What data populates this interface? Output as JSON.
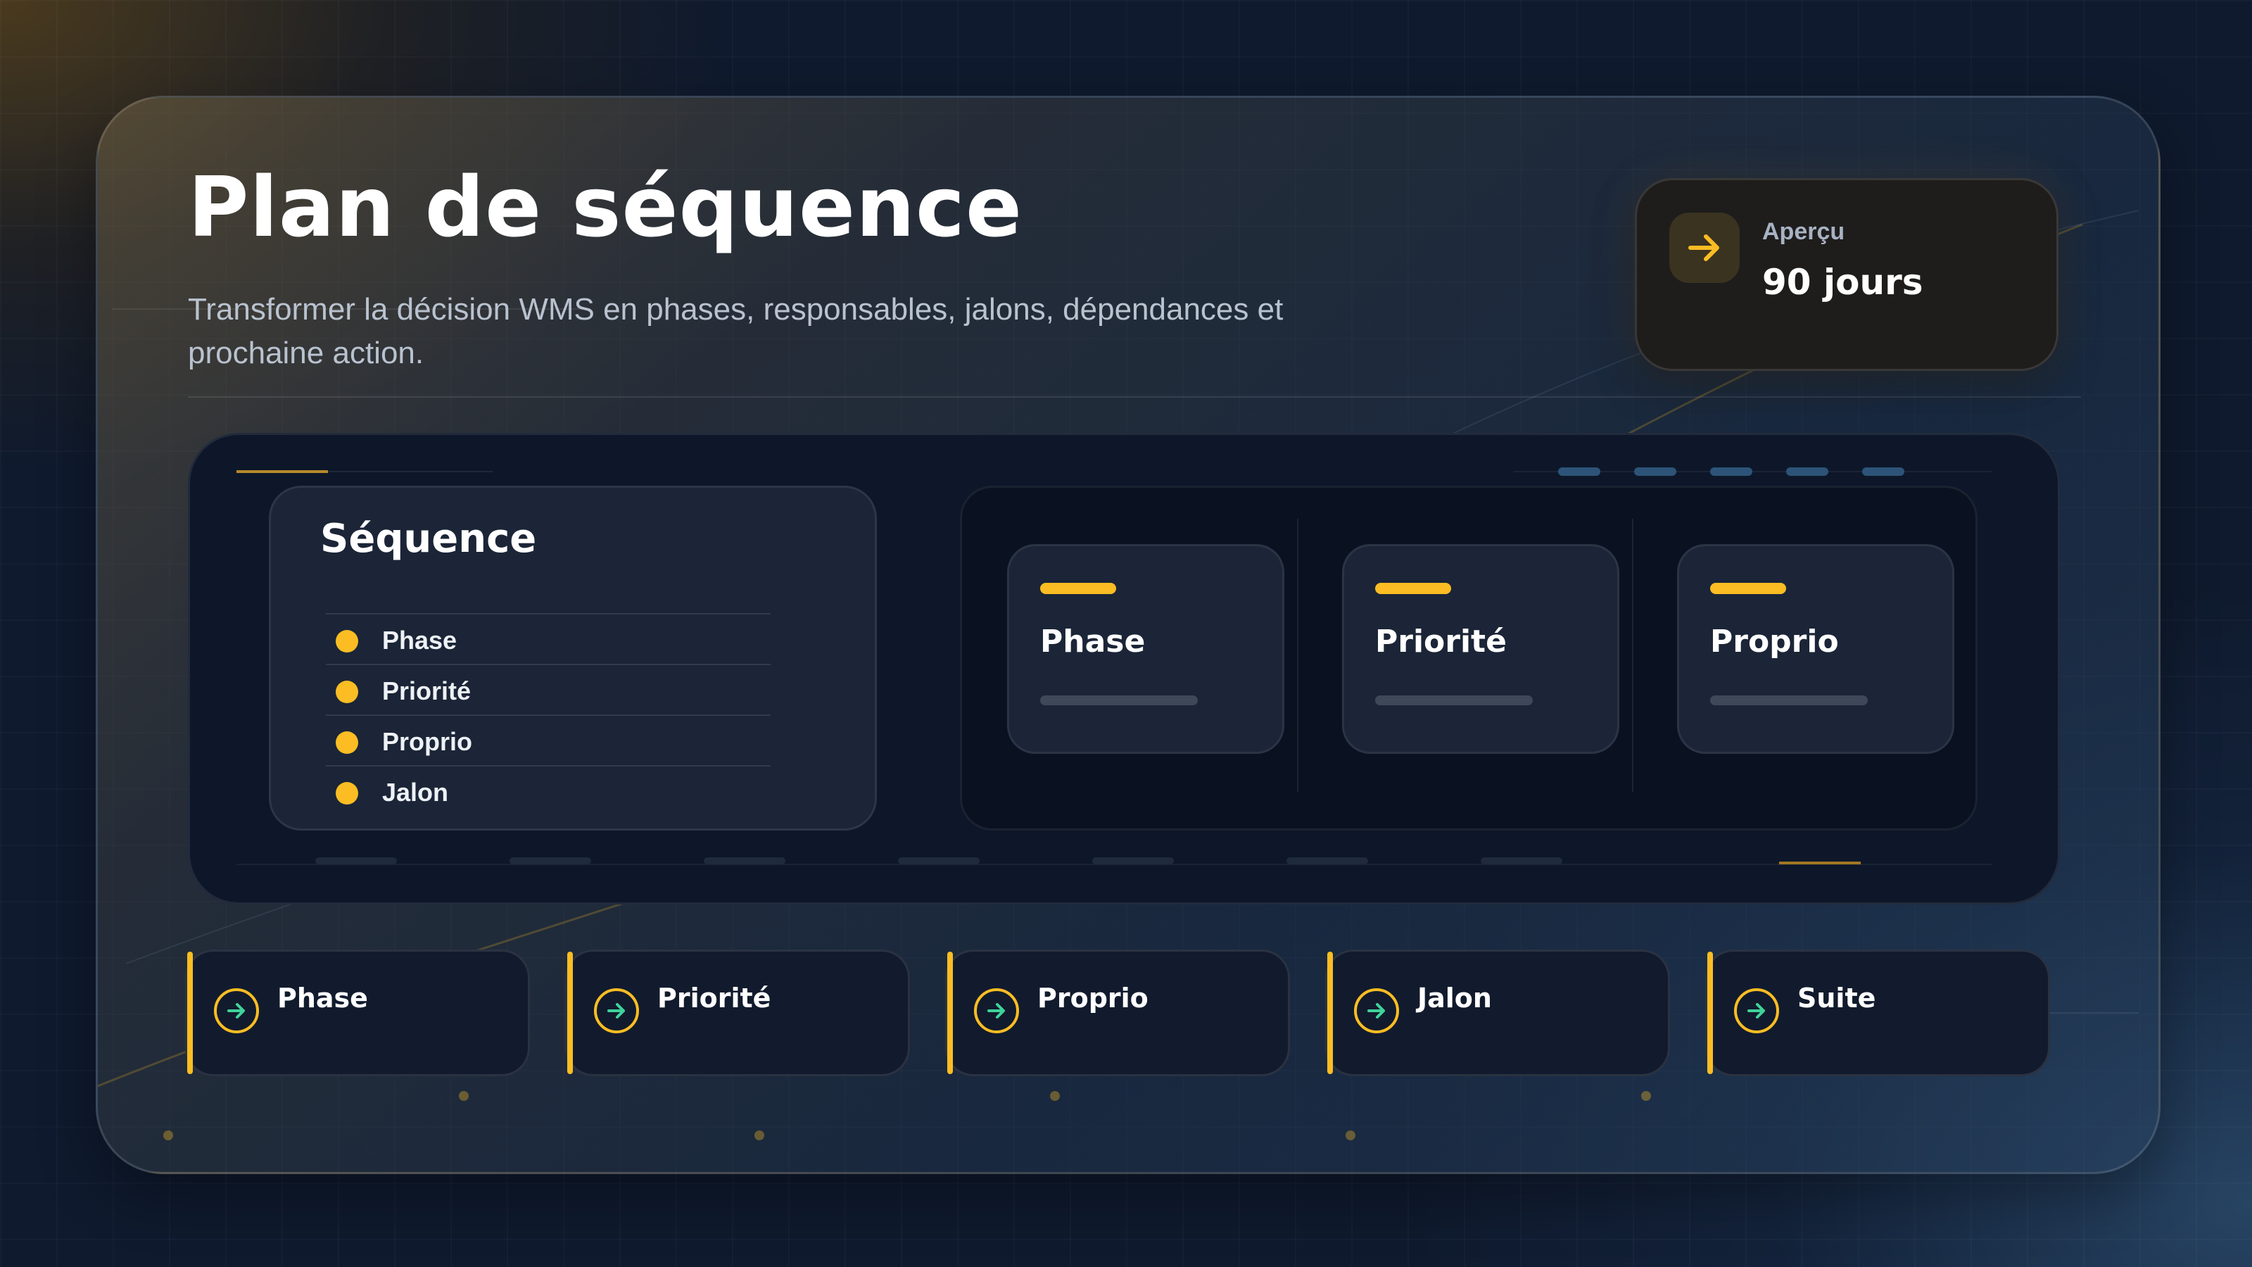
{
  "header": {
    "title": "Plan de séquence",
    "subtitle": "Transformer la décision WMS en phases, responsables, jalons, dépendances et prochaine action."
  },
  "apercu": {
    "label": "Aperçu",
    "value": "90 jours",
    "icon": "arrow-right-icon"
  },
  "sequence": {
    "title": "Séquence",
    "items": [
      {
        "label": "Phase"
      },
      {
        "label": "Priorité"
      },
      {
        "label": "Proprio"
      },
      {
        "label": "Jalon"
      }
    ]
  },
  "columns": [
    {
      "title": "Phase"
    },
    {
      "title": "Priorité"
    },
    {
      "title": "Proprio"
    }
  ],
  "steps": [
    {
      "label": "Phase",
      "icon": "arrow-right-circle-icon"
    },
    {
      "label": "Priorité",
      "icon": "arrow-right-circle-icon"
    },
    {
      "label": "Proprio",
      "icon": "arrow-right-circle-icon"
    },
    {
      "label": "Jalon",
      "icon": "arrow-right-circle-icon"
    },
    {
      "label": "Suite",
      "icon": "arrow-right-circle-icon"
    }
  ],
  "colors": {
    "accent": "#fbbd23",
    "icon_arrow": "#3fd39a",
    "panel": "#0d1729",
    "card": "#1b2537"
  }
}
